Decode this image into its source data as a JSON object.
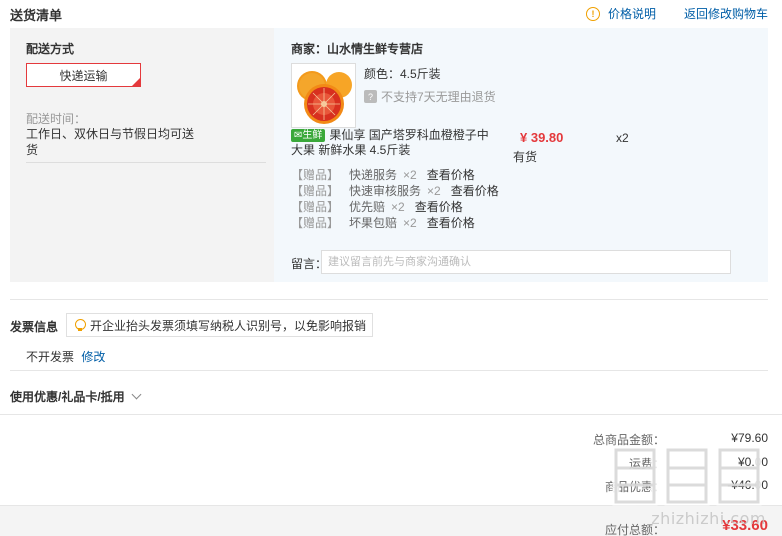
{
  "header": {
    "title": "送货清单",
    "price_info_label": "价格说明",
    "back_to_cart_label": "返回修改购物车"
  },
  "shipping": {
    "label": "配送方式",
    "method": "快递运输",
    "time_label": "配送时间：",
    "time_value": "工作日、双休日与节假日均可送货"
  },
  "shop": {
    "name": "商家：山水情生鲜专营店",
    "product": {
      "badge": "生鲜",
      "name": "果仙享 国产塔罗科血橙橙子中大果 新鲜水果 4.5斤装",
      "color_label": "颜色：4.5斤装",
      "return_policy": "不支持7天无理由退货",
      "price": "¥ 39.80",
      "stock": "有货",
      "quantity": "x2"
    },
    "gifts": [
      {
        "tag": "【赠品】",
        "name": "快递服务",
        "qty": "×2",
        "link": "查看价格"
      },
      {
        "tag": "【赠品】",
        "name": "快速审核服务",
        "qty": "×2",
        "link": "查看价格"
      },
      {
        "tag": "【赠品】",
        "name": "优先赔",
        "qty": "×2",
        "link": "查看价格"
      },
      {
        "tag": "【赠品】",
        "name": "坏果包赔",
        "qty": "×2",
        "link": "查看价格"
      }
    ],
    "message_label": "留言：",
    "message_placeholder": "建议留言前先与商家沟通确认"
  },
  "invoice": {
    "label": "发票信息",
    "tip": "开企业抬头发票须填写纳税人识别号，以免影响报销",
    "status": "不开发票",
    "edit_label": "修改"
  },
  "coupon": {
    "label": "使用优惠/礼品卡/抵用"
  },
  "summary": {
    "rows": [
      {
        "label": "总商品金额：",
        "value": "¥79.60"
      },
      {
        "label": "运费：",
        "value": "¥0.00"
      },
      {
        "label": "商品优惠：",
        "value": "-¥46.00"
      }
    ],
    "total_label": "应付总额：",
    "total_value": "¥33.60"
  },
  "watermark": {
    "text": "zhizhizhi.com"
  },
  "colors": {
    "accent_red": "#e4393c",
    "link_blue": "#005ea7",
    "fresh_green": "#3aa83a",
    "warning_orange": "#f0a000"
  }
}
